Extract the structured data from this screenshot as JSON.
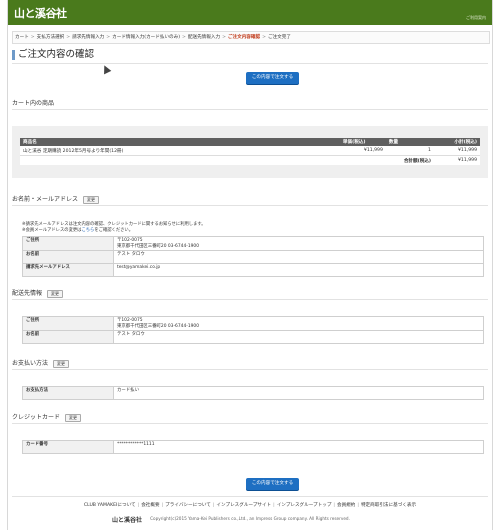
{
  "header": {
    "logo": "山と溪谷社",
    "top_link": "ご利用案内"
  },
  "breadcrumb": [
    {
      "label": "カート",
      "active": false
    },
    {
      "label": "支払方法選択",
      "active": false
    },
    {
      "label": "請求先情報入力",
      "active": false
    },
    {
      "label": "カード情報入力(カード払いのみ)",
      "active": false
    },
    {
      "label": "配送先情報入力",
      "active": false
    },
    {
      "label": "ご注文内容確認",
      "active": true
    },
    {
      "label": "ご注文完了",
      "active": false
    }
  ],
  "page": {
    "title": "ご注文内容の確認",
    "confirm_button": "この内容で注文する"
  },
  "cart": {
    "section_title": "カート内の商品",
    "columns": {
      "product": "商品名",
      "unit_price": "単価(税込)",
      "qty": "数量",
      "subtotal": "小計(税込)"
    },
    "rows": [
      {
        "product": "山と溪谷 定期購読 2012年5月号より年間(12冊)",
        "unit_price": "¥11,999",
        "qty": "1",
        "subtotal": "¥11,999"
      }
    ],
    "total_label": "合計額(税込)",
    "total_value": "¥11,999"
  },
  "name_email": {
    "section_title": "お名前・メールアドレス",
    "change_label": "変更",
    "note_line1": "※請求先メールアドレスは注文内容の確認、クレジットカードに関するお知らせに利用します。",
    "note_line2_prefix": "※会員メールアドレスの変更は",
    "note_link": "こちら",
    "note_line2_suffix": "をご確認ください。",
    "address_label": "ご住所",
    "address_zip": "〒102-0075",
    "address_line": "東京都千代田区三番町20 03-6744-1900",
    "name_label": "お名前",
    "name_value": "テスト タロウ",
    "email_label": "請求先メールアドレス",
    "email_value": "test@yamakei.co.jp"
  },
  "delivery": {
    "section_title": "配送先情報",
    "change_label": "変更",
    "address_label": "ご住所",
    "address_zip": "〒102-0075",
    "address_line": "東京都千代田区三番町20 03-6744-1900",
    "name_label": "お名前",
    "name_value": "テスト タロウ"
  },
  "payment": {
    "section_title": "お支払い方法",
    "change_label": "変更",
    "method_label": "お支払方法",
    "method_value": "カード払い"
  },
  "credit": {
    "section_title": "クレジットカード",
    "change_label": "変更",
    "card_label": "カード番号",
    "card_value": "************1111"
  },
  "footer": {
    "links": [
      "CLUB YAMAKEIについて",
      "会社概要",
      "プライバシーについて",
      "インプレスグループサイト",
      "インプレスグループトップ",
      "会員規約",
      "特定商取引法に基づく表示"
    ],
    "logo": "山と溪谷社",
    "copyright": "Copyright(c)2015 Yama-Kei Publishers co.,Ltd., an Impress Group company. All Rights reserved."
  }
}
